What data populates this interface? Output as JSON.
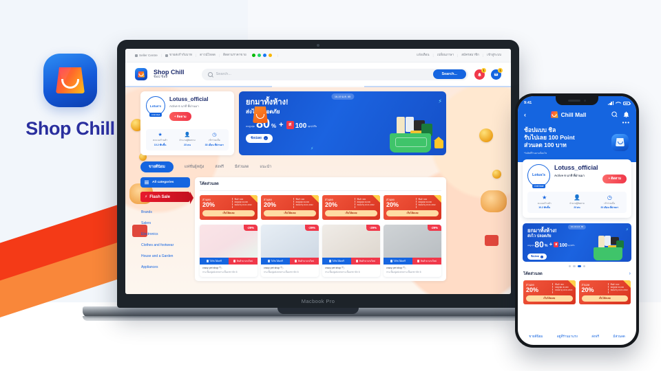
{
  "brand": {
    "name": "Shop Chill",
    "logo_icon": "shopping-bag-icon"
  },
  "laptop": {
    "model_label": "Macbook Pro",
    "topbar": {
      "left_items": [
        "Seller Centre",
        "ขายส่งกำกับบาท",
        "ดาวน์โหลด",
        "ติดตามราคาขาย"
      ],
      "right_items": [
        "แจ้งเตือน",
        "เปลี่ยนภาษา",
        "สมัครสมาชิก",
        "เข้าสู่ระบบ"
      ],
      "social_icons": [
        "line-icon",
        "whatsapp-icon",
        "facebook-icon",
        "instagram-icon"
      ]
    },
    "header": {
      "title": "Shop Chill",
      "subtitle": "ช้อป ชิลล์",
      "search_placeholder": "Search...",
      "search_button": "Search...",
      "notification_count": "1",
      "mail_count": "1"
    },
    "store": {
      "logo_text": "Lotus's",
      "logo_sub": "Chill Mall",
      "name": "Lotuss_official",
      "meta": "Active 6 นาที ที่ผ่านมา",
      "follow_button": "+ ติดตาม",
      "stats": [
        {
          "icon": "star-icon",
          "label": "คะแนนร้านค้า",
          "value": "10.2 พันชิ้น"
        },
        {
          "icon": "followers-icon",
          "label": "จำนวนผู้ติดตาม",
          "value": "23 คน"
        },
        {
          "icon": "clock-icon",
          "label": "เข้าร่วมเมื่อ",
          "value": "33 เดือน ที่ผ่านมา"
        }
      ]
    },
    "hero": {
      "date_badge": "16-19 ม.ค. 65",
      "headline": "ยกมาทั้งห้าง!",
      "subhead": "ส่งไว ปลอดภัย",
      "discount_pre": "ลดสูงสุด",
      "discount_value": "80",
      "discount_pct": "%",
      "plus": "+",
      "coupon_value": "100",
      "coupon_unit": ".-",
      "coupon_note": "ทุกๆ10ใบ",
      "cta": "ช้อปเลย"
    },
    "tabs": [
      {
        "label": "ขายดีนิยม",
        "active": true
      },
      {
        "label": "แฟชั่นผู้หญิง",
        "active": false
      },
      {
        "label": "ส่งฟรี",
        "active": false
      },
      {
        "label": "มีส่วนลด",
        "active": false
      },
      {
        "label": "แนะนำ",
        "active": false
      }
    ],
    "sidebar": {
      "all_categories": "All categories",
      "flash_sale": "Flash Sale",
      "categories": [
        "Brands",
        "Salers",
        "Electronics",
        "Clothes and footwear",
        "House and a Garden",
        "Appliances"
      ]
    },
    "voucher_section": {
      "title": "โค้ดส่วนลด",
      "vouchers": [
        {
          "label": "ส่วนลด",
          "percent": "20%",
          "cond1": "ขั้นต่ำ 300",
          "cond2": "ลดสูงสุด 30,000",
          "cond3": "หมดอายุ 19.01.2022",
          "button": "เก็บโค้ดเลย"
        },
        {
          "label": "ส่วนลด",
          "percent": "20%",
          "cond1": "ขั้นต่ำ 300",
          "cond2": "ลดสูงสุด 30,000",
          "cond3": "หมดอายุ 19.01.2022",
          "button": "เก็บโค้ดเลย"
        },
        {
          "label": "ส่วนลด",
          "percent": "20%",
          "cond1": "ขั้นต่ำ 300",
          "cond2": "ลดสูงสุด 30,000",
          "cond3": "หมดอายุ 19.01.2022",
          "button": "เก็บโค้ดเลย"
        },
        {
          "label": "ส่วนลด",
          "percent": "20%",
          "cond1": "ขั้นต่ำ 300",
          "cond2": "ลดสูงสุด 30,000",
          "cond3": "หมดอายุ 19.01.2022",
          "button": "เก็บโค้ดเลย"
        }
      ]
    },
    "products": [
      {
        "discount": "-29%",
        "tag_free": "ได้รับโค้ดฟรี",
        "tag_hot": "สินค้ามาแรงใหม่",
        "shop": "crazy pet shop 🏷",
        "desc": "กระเบื้องปูผนังลายกระเบื้องเซรามิก 6"
      },
      {
        "discount": "-29%",
        "tag_free": "ได้รับโค้ดฟรี",
        "tag_hot": "สินค้ามาแรงใหม่",
        "shop": "crazy pet shop 🏷",
        "desc": "กระเบื้องปูผนังลายกระเบื้องเซรามิก 6"
      },
      {
        "discount": "-29%",
        "tag_free": "ได้รับโค้ดฟรี",
        "tag_hot": "สินค้ามาแรงใหม่",
        "shop": "crazy pet shop 🏷",
        "desc": "กระเบื้องปูผนังลายกระเบื้องเซรามิก 6"
      },
      {
        "discount": "-29%",
        "tag_free": "ได้รับโค้ดฟรี",
        "tag_hot": "สินค้ามาแรงใหม่",
        "shop": "crazy pet shop 🏷",
        "desc": "กระเบื้องปูผนังลายกระเบื้องเซรามิก 6"
      }
    ]
  },
  "phone": {
    "status": {
      "time": "9:41",
      "signal_icon": "cellular-bars-icon",
      "wifi_icon": "wifi-icon",
      "battery_icon": "battery-icon"
    },
    "nav": {
      "back_icon": "chevron-left-icon",
      "title": "Chill Mall",
      "search_icon": "search-icon",
      "bell_icon": "bell-icon",
      "more_icon": "more-dots-icon"
    },
    "promo": {
      "line1": "ช้อปแบบ ชิล",
      "line2": "รับไปเลย 100 Point",
      "line3": "ส่วนลด 100 บาท",
      "note": "*รับสิทธิ์ร้านตามเงื่อนไข"
    },
    "store": {
      "logo_text": "Lotus's",
      "logo_sub": "Chill Mall",
      "name": "Lotuss_official",
      "meta": "Active 6 นาที ที่ผ่านมา",
      "follow_button": "+ ติดตาม",
      "stats": [
        {
          "icon": "star-icon",
          "label": "คะแนนร้านค้า",
          "value": "10.2 พันชิ้น"
        },
        {
          "icon": "followers-icon",
          "label": "จำนวนผู้ติดตาม",
          "value": "23 คน"
        },
        {
          "icon": "clock-icon",
          "label": "เข้าร่วมเมื่อ",
          "value": "33 เดือน ที่ผ่านมา"
        }
      ]
    },
    "banner": {
      "date_badge": "16-19 ม.ค. 65",
      "headline": "ยกมาทั้งห้าง!",
      "subhead": "ส่งไว ปลอดภัย",
      "discount_pre": "ลดสูงสุด",
      "discount_value": "80",
      "discount_pct": "%",
      "plus": "+",
      "coupon_value": "100",
      "coupon_unit": ".-",
      "coupon_note": "ทุกๆ10ใบ",
      "cta": "ช้อปเลย"
    },
    "carousel": {
      "total": 4,
      "active_index": 2
    },
    "voucher_section": {
      "title": "โค้ดส่วนลด",
      "chevron": "›",
      "vouchers": [
        {
          "label": "ส่วนลด",
          "percent": "20%",
          "cond1": "ขั้นต่ำ 300",
          "cond2": "ลดสูงสุด 30,000",
          "cond3": "หมดอายุ 19.01.2022",
          "button": "เก็บโค้ดเลย"
        },
        {
          "label": "ส่วนลด",
          "percent": "20%",
          "cond1": "ขั้นต่ำ 300",
          "cond2": "ลดสูงสุด 30,000",
          "cond3": "หมดอายุ 19.01.2022",
          "button": "เก็บโค้ดเลย"
        }
      ]
    },
    "tabs": [
      "ขายดีนิยม",
      "อยู่ที่ร้านมาแรง",
      "ส่งฟรี",
      "มีส่วนลด"
    ]
  },
  "colors": {
    "brand_blue": "#1565e0",
    "deep_blue": "#1b2a6b",
    "accent_red": "#f0384a",
    "accent_orange": "#f9873a",
    "ribbon_red": "#f43a17",
    "voucher_red": "#d93420",
    "flash_red": "#c3101f",
    "yellow": "#ffc727"
  }
}
